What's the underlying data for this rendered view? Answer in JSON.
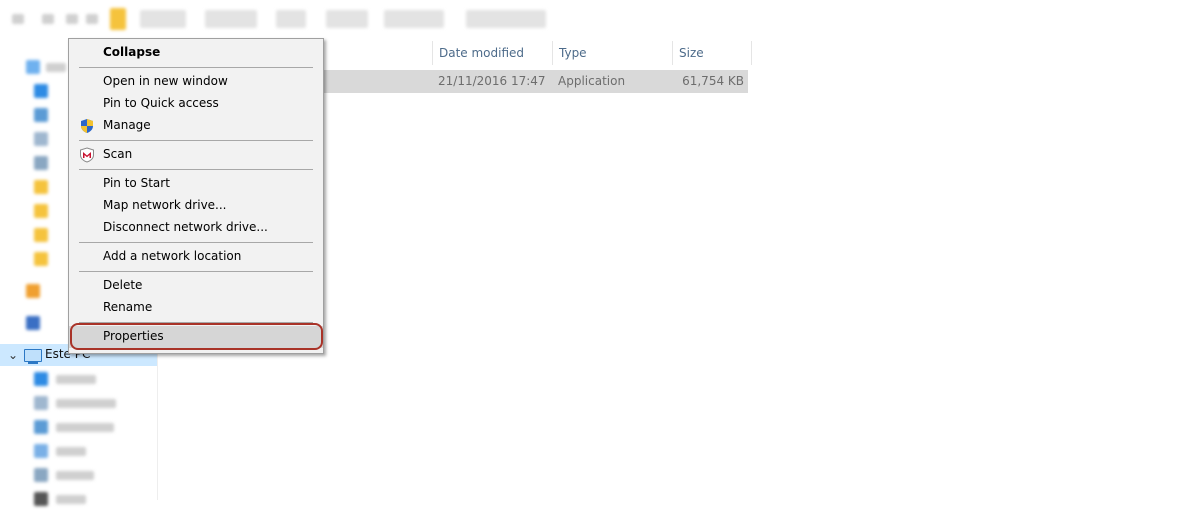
{
  "sidebar": {
    "this_pc_label": "Este PC"
  },
  "file_list": {
    "columns": {
      "date_modified": "Date modified",
      "type": "Type",
      "size": "Size"
    },
    "rows": [
      {
        "date_modified": "21/11/2016 17:47",
        "type": "Application",
        "size": "61,754 KB"
      }
    ]
  },
  "context_menu": {
    "items": [
      {
        "label": "Collapse",
        "bold": true
      },
      {
        "label": "Open in new window"
      },
      {
        "label": "Pin to Quick access"
      },
      {
        "label": "Manage",
        "icon": "uac-shield-icon"
      },
      {
        "label": "Scan",
        "icon": "mcafee-icon"
      },
      {
        "label": "Pin to Start"
      },
      {
        "label": "Map network drive..."
      },
      {
        "label": "Disconnect network drive..."
      },
      {
        "label": "Add a network location"
      },
      {
        "label": "Delete"
      },
      {
        "label": "Rename"
      },
      {
        "label": "Properties",
        "highlighted": true
      }
    ],
    "highlight_color": "#a93328"
  }
}
